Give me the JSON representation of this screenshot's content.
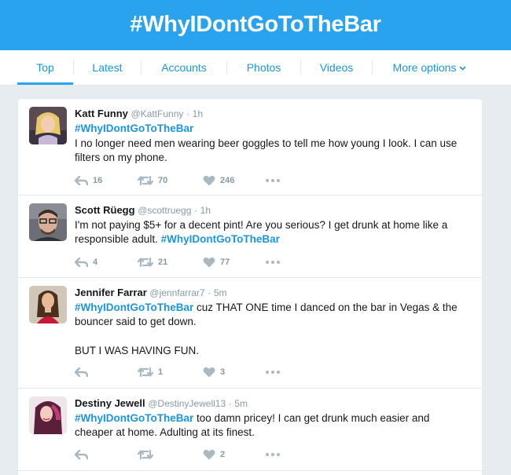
{
  "banner": {
    "title": "#WhyIDontGoToTheBar"
  },
  "nav": {
    "tabs": [
      {
        "label": "Top"
      },
      {
        "label": "Latest"
      },
      {
        "label": "Accounts"
      },
      {
        "label": "Photos"
      },
      {
        "label": "Videos"
      },
      {
        "label": "More options"
      }
    ]
  },
  "tweets": [
    {
      "name": "Katt Funny",
      "handle": "@KattFunny",
      "time": "1h",
      "hashtag": "#WhyIDontGoToTheBar",
      "text": "I no longer need men wearing beer goggles to tell me how young I look.  I can use filters on my phone.",
      "replies": "16",
      "retweets": "70",
      "likes": "246"
    },
    {
      "name": "Scott Rüegg",
      "handle": "@scottruegg",
      "time": "1h",
      "text": "I'm not paying $5+ for a decent pint! Are you serious? I get drunk at home like a responsible adult.",
      "hashtag": "#WhyIDontGoToTheBar",
      "replies": "4",
      "retweets": "21",
      "likes": "77"
    },
    {
      "name": "Jennifer Farrar",
      "handle": "@jennfarrar7",
      "time": "5m",
      "hashtag": "#WhyIDontGoToTheBar",
      "text": "cuz THAT ONE time I danced on the bar in Vegas & the bouncer said to get down.",
      "text2": "BUT I WAS HAVING FUN.",
      "replies": "",
      "retweets": "1",
      "likes": "3"
    },
    {
      "name": "Destiny Jewell",
      "handle": "@DestinyJewell13",
      "time": "5m",
      "hashtag": "#WhyIDontGoToTheBar",
      "text": "too damn pricey! I can get drunk much easier and cheaper at home. Adulting at its finest.",
      "replies": "",
      "retweets": "",
      "likes": "2"
    }
  ],
  "ui": {
    "dot": "·"
  },
  "colors": {
    "banner": "#2aa3ef",
    "link": "#1b95e0",
    "muted": "#8899a6",
    "background": "#e6ecf0"
  }
}
